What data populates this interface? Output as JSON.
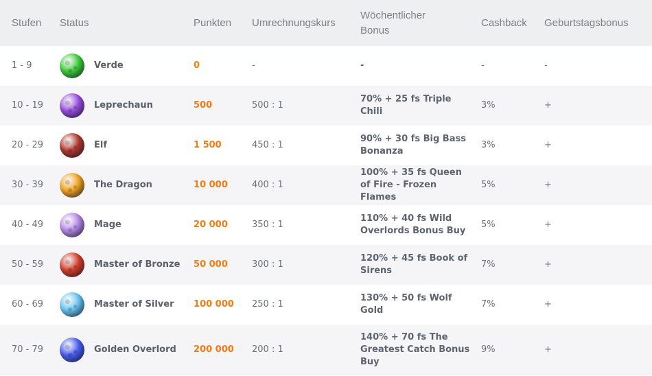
{
  "header": {
    "levels": "Stufen",
    "status": "Status",
    "points": "Punkten",
    "rate": "Umrechnungskurs",
    "weekly_bonus": "Wöchentlicher Bonus",
    "cashback": "Cashback",
    "birthday_bonus": "Geburtstagsbonus"
  },
  "rows": [
    {
      "level": "1 - 9",
      "status": "Verde",
      "icon": "green-planet-icon",
      "icon_color": "#3fcf3a",
      "points": "0",
      "rate": "-",
      "bonus": "-",
      "cashback": "-",
      "birthday": "-"
    },
    {
      "level": "10 - 19",
      "status": "Leprechaun",
      "icon": "purple-planet-icon",
      "icon_color": "#9b4fe0",
      "points": "500",
      "rate": "500 : 1",
      "bonus": "70% + 25 fs Triple Chili",
      "cashback": "3%",
      "birthday": "+"
    },
    {
      "level": "20 - 29",
      "status": "Elf",
      "icon": "red-rock-planet-icon",
      "icon_color": "#b23a2e",
      "points": "1 500",
      "rate": "450 : 1",
      "bonus": "90% + 30 fs Big Bass Bonanza",
      "cashback": "3%",
      "birthday": "+"
    },
    {
      "level": "30 - 39",
      "status": "The Dragon",
      "icon": "orange-planet-icon",
      "icon_color": "#f5a623",
      "points": "10 000",
      "rate": "400 : 1",
      "bonus": "100% + 35 fs Queen of Fire - Frozen Flames",
      "cashback": "5%",
      "birthday": "+"
    },
    {
      "level": "40 - 49",
      "status": "Mage",
      "icon": "lilac-planet-icon",
      "icon_color": "#b98be8",
      "points": "20 000",
      "rate": "350 : 1",
      "bonus": "110% + 40 fs Wild Overlords Bonus Buy",
      "cashback": "5%",
      "birthday": "+"
    },
    {
      "level": "50 - 59",
      "status": "Master of Bronze",
      "icon": "lava-planet-icon",
      "icon_color": "#d6402c",
      "points": "50 000",
      "rate": "300 : 1",
      "bonus": "120% + 45 fs Book of Sirens",
      "cashback": "7%",
      "birthday": "+"
    },
    {
      "level": "60 - 69",
      "status": "Master of Silver",
      "icon": "ice-planet-icon",
      "icon_color": "#6cc6f2",
      "points": "100 000",
      "rate": "250 : 1",
      "bonus": "130% + 50 fs Wolf Gold",
      "cashback": "7%",
      "birthday": "+"
    },
    {
      "level": "70 - 79",
      "status": "Golden Overlord",
      "icon": "blue-planet-icon",
      "icon_color": "#4a5ff0",
      "points": "200 000",
      "rate": "200 : 1",
      "bonus": "140% + 70 fs The Greatest Catch Bonus Buy",
      "cashback": "9%",
      "birthday": "+"
    }
  ]
}
